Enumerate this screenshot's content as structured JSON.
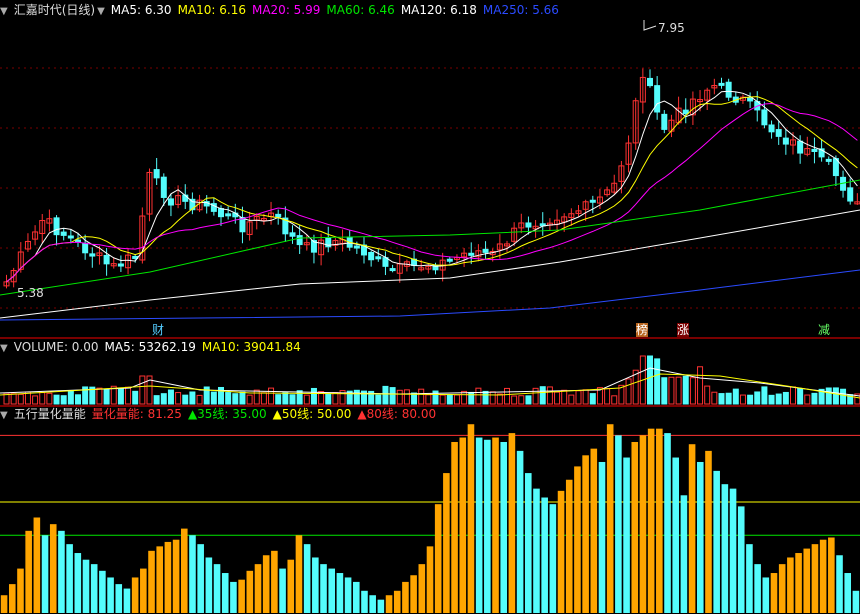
{
  "colors": {
    "bg": "#000000",
    "up": "#ff3232",
    "down": "#54fcfc",
    "ma5": "#ffffff",
    "ma10": "#ffff00",
    "ma20": "#ff00ff",
    "ma60": "#00e600",
    "ma120": "#ffffff",
    "ma250": "#2b4bff",
    "orange": "#ffa500",
    "grid": "#7a0000"
  },
  "price_panel": {
    "title": "汇嘉时代(日线)",
    "ma5_label": "MA5: 6.30",
    "ma10_label": "MA10: 6.16",
    "ma20_label": "MA20: 5.99",
    "ma60_label": "MA60: 6.46",
    "ma120_label": "MA120: 6.18",
    "ma250_label": "MA250: 5.66",
    "high_label": "7.95",
    "low_label": "5.38",
    "markers": [
      {
        "text": "财",
        "color": "#55ccff"
      },
      {
        "text": "榜",
        "color": "#ffffff",
        "bg": "#b8651e"
      },
      {
        "text": "涨",
        "color": "#ffffff",
        "bg": "#7a0000"
      },
      {
        "text": "减",
        "color": "#66ff66"
      }
    ]
  },
  "volume_panel": {
    "volume_label": "VOLUME: 0.00",
    "ma5_label": "MA5: 53262.19",
    "ma10_label": "MA10: 39041.84"
  },
  "indicator_panel": {
    "title": "五行量化量能",
    "main_label": "量化量能: 81.25",
    "line35_label": "▲35线: 35.00",
    "line50_label": "▲50线: 50.00",
    "line80_label": "▲80线: 80.00"
  },
  "chart_data": {
    "type": "bar",
    "title": "五行量化量能",
    "guide_lines": [
      35,
      50,
      80
    ],
    "values": [
      8,
      13,
      20,
      37,
      43,
      35,
      40,
      37,
      31,
      27,
      24,
      22,
      19,
      16,
      13,
      11,
      16,
      20,
      28,
      30,
      32,
      33,
      38,
      35,
      31,
      25,
      22,
      18,
      14,
      15,
      19,
      22,
      26,
      28,
      20,
      24,
      35,
      31,
      25,
      22,
      20,
      18,
      16,
      14,
      10,
      8,
      6,
      8,
      10,
      14,
      17,
      22,
      30,
      49,
      63,
      77,
      79,
      85,
      79,
      78,
      79,
      77,
      81,
      73,
      63,
      56,
      52,
      49,
      55,
      60,
      66,
      71,
      74,
      68,
      85,
      80,
      70,
      77,
      80,
      83,
      83,
      81,
      70,
      53,
      76,
      68,
      73,
      64,
      58,
      56,
      48,
      31,
      22,
      16,
      18,
      22,
      25,
      27,
      29,
      31,
      33,
      34,
      26,
      18,
      10
    ]
  }
}
